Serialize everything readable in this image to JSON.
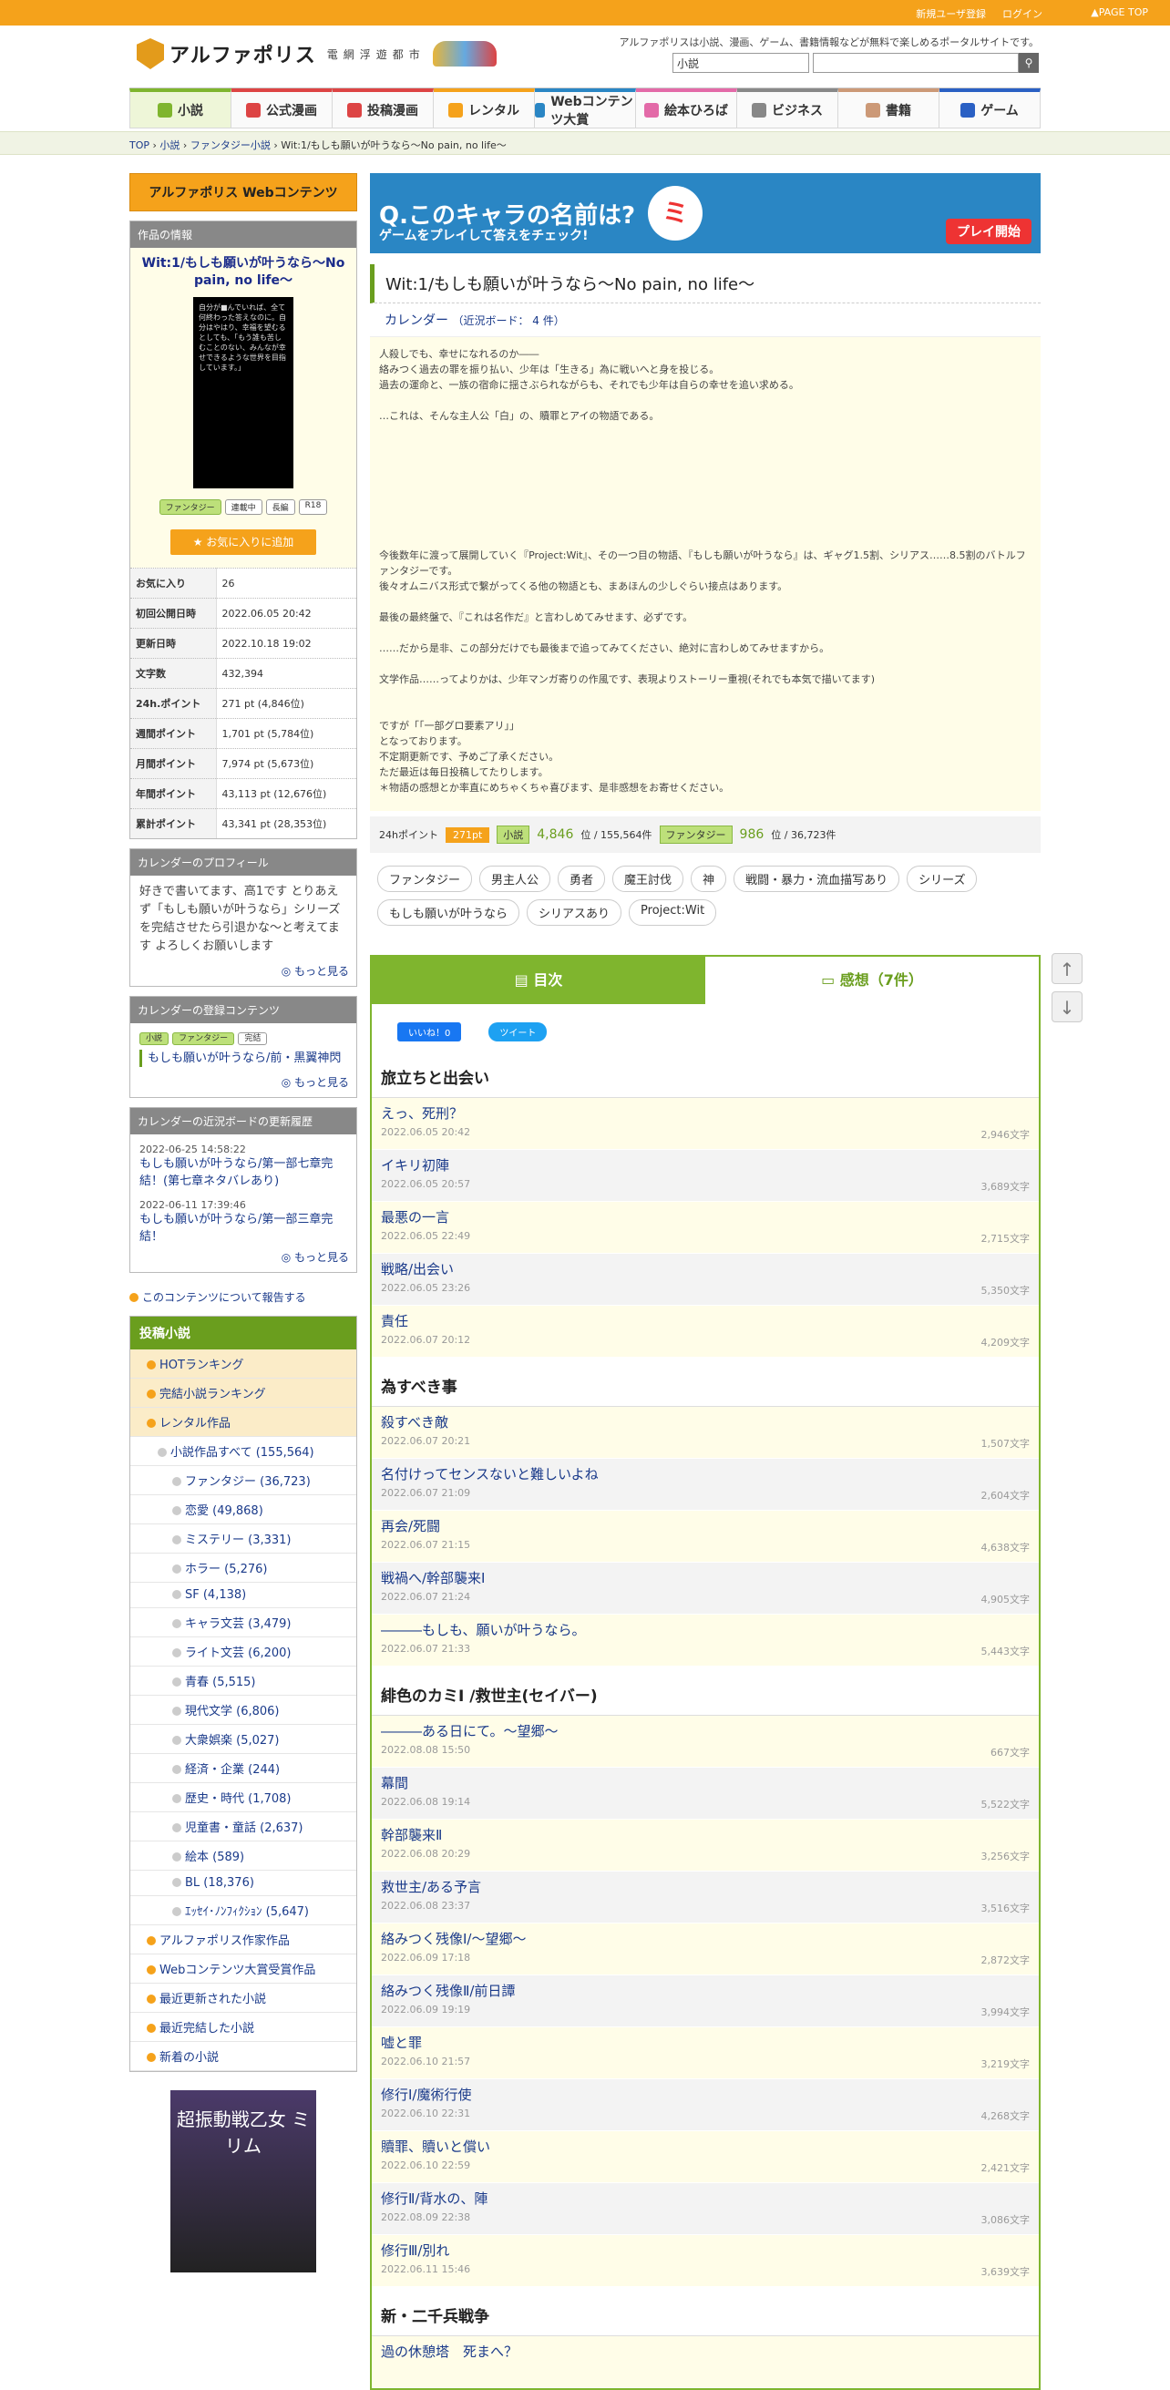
{
  "topbar": {
    "signup": "新規ユーザ登録",
    "login": "ログイン",
    "pagetop": "PAGE TOP"
  },
  "header": {
    "site_name": "アルファポリス",
    "site_sub": "電網浮遊都市",
    "tagline": "アルファポリスは小説、漫画、ゲーム、書籍情報などが無料で楽しめるポータルサイトです。",
    "search_category": "小説",
    "search_button": "search-icon"
  },
  "nav": [
    "小説",
    "公式漫画",
    "投稿漫画",
    "レンタル",
    "Webコンテンツ大賞",
    "絵本ひろば",
    "ビジネス",
    "書籍",
    "ゲーム"
  ],
  "breadcrumb": [
    "TOP",
    "小説",
    "ファンタジー小説",
    "Wit:1/もしも願いが叶うなら〜No pain, no life〜"
  ],
  "left": {
    "wc_banner": "アルファポリス Webコンテンツ",
    "info_header": "作品の情報",
    "work_title": "Wit:1/もしも願いが叶うなら〜No pain, no life〜",
    "cover_text": "自分が■んでいれば、全て何終わった答えなのに。自分はやはり、幸福を望むるとしても、「もう誰も苦しむことのない、みんなが幸せできるような世界を目指しています。」",
    "tags": [
      "ファンタジー",
      "連載中",
      "長編",
      "R18"
    ],
    "fav_button": "お気に入りに追加",
    "stats": [
      [
        "お気に入り",
        "26"
      ],
      [
        "初回公開日時",
        "2022.06.05 20:42"
      ],
      [
        "更新日時",
        "2022.10.18 19:02"
      ],
      [
        "文字数",
        "432,394"
      ],
      [
        "24h.ポイント",
        "271 pt (4,846位)"
      ],
      [
        "週間ポイント",
        "1,701 pt (5,784位)"
      ],
      [
        "月間ポイント",
        "7,974 pt (5,673位)"
      ],
      [
        "年間ポイント",
        "43,113 pt (12,676位)"
      ],
      [
        "累計ポイント",
        "43,341 pt (28,353位)"
      ]
    ],
    "profile_header": "カレンダーのプロフィール",
    "profile_text": "好きで書いてます、高1です とりあえず「もしも願いが叶うなら」シリーズを完結させたら引退かな〜と考えてます よろしくお願いします",
    "more": "もっと見る",
    "contents_header": "カレンダーの登録コンテンツ",
    "contents_tags": [
      "小説",
      "ファンタジー",
      "完結"
    ],
    "contents_title": "もしも願いが叶うなら/前・黒翼神閃",
    "history_header": "カレンダーの近況ボードの更新履歴",
    "history": [
      {
        "date": "2022-06-25 14:58:22",
        "title": "もしも願いが叶うなら/第一部七章完結！(第七章ネタバレあり)"
      },
      {
        "date": "2022-06-11 17:39:46",
        "title": "もしも願いが叶うなら/第一部三章完結！"
      }
    ],
    "report": "このコンテンツについて報告する",
    "menu_header": "投稿小説",
    "menu_items": [
      "HOTランキング",
      "完結小説ランキング",
      "レンタル作品",
      "小説作品すべて (155,564)"
    ],
    "menu_sub": [
      "ファンタジー (36,723)",
      "恋愛 (49,868)",
      "ミステリー (3,331)",
      "ホラー (5,276)",
      "SF (4,138)",
      "キャラ文芸 (3,479)",
      "ライト文芸 (6,200)",
      "青春 (5,515)",
      "現代文学 (6,806)",
      "大衆娯楽 (5,027)",
      "経済・企業 (244)",
      "歴史・時代 (1,708)",
      "児童書・童話 (2,637)",
      "絵本 (589)",
      "BL (18,376)",
      "ｴｯｾｲ･ﾉﾝﾌｨｸｼｮﾝ (5,647)"
    ],
    "menu_tail": [
      "アルファポリス作家作品",
      "Webコンテンツ大賞受賞作品",
      "最近更新された小説",
      "最近完結した小説",
      "新着の小説"
    ],
    "book_title": "超振動戦乙女 ミリム"
  },
  "main": {
    "ad": {
      "headline": "Q.このキャラの名前は?",
      "sub": "ゲームをプレイして答えをチェック!",
      "q": "ミ",
      "play": "プレイ開始"
    },
    "title": "Wit:1/もしも願いが叶うなら〜No pain, no life〜",
    "author": "カレンダー",
    "board": "（近況ボード： 4 件）",
    "synopsis": [
      "人殺しでも、幸せになれるのか――",
      "絡みつく過去の罪を振り払い、少年は「生きる」為に戦いへと身を投じる。",
      "過去の運命と、一族の宿命に揺さぶられながらも、それでも少年は自らの幸せを追い求める。",
      "",
      "…これは、そんな主人公「白」の、贖罪とアイの物語である。",
      "",
      "",
      "",
      "",
      "",
      "",
      "",
      "",
      "今後数年に渡って展開していく『Project:Wit』、その一つ目の物語、『もしも願いが叶うなら』は、ギャグ1.5割、シリアス……8.5割のバトルファンタジーです。",
      "後々オムニバス形式で繋がってくる他の物語とも、まあほんの少しぐらい接点はあります。",
      "",
      "最後の最終盤で、『これは名作だ』と言わしめてみせます、必ずです。",
      "",
      "……だから是非、この部分だけでも最後まで追ってみてください、絶対に言わしめてみせますから。",
      "",
      "文学作品……ってよりかは、少年マンガ寄りの作風です、表現よりストーリー重視(それでも本気で描いてます)",
      "",
      "",
      "ですが「「一部グロ要素アリ」」",
      "となっております。",
      "不定期更新です、予めご了承ください。",
      "ただ最近は毎日投稿してたりします。",
      "＊物語の感想とか率直にめちゃくちゃ喜びます、是非感想をお寄せください。"
    ],
    "points": {
      "label": "24hポイント",
      "badge": "271pt",
      "cat1": "小説",
      "rank1": "4,846",
      "total1": "位 / 155,564件",
      "cat2": "ファンタジー",
      "rank2": "986",
      "total2": "位 / 36,723件"
    },
    "keywords": [
      "ファンタジー",
      "男主人公",
      "勇者",
      "魔王討伐",
      "神",
      "戦闘・暴力・流血描写あり",
      "シリーズ",
      "もしも願いが叶うなら",
      "シリアスあり",
      "Project:Wit"
    ],
    "tabs": {
      "toc": "目次",
      "reviews": "感想（7件）"
    },
    "social": {
      "like": "いいね！0",
      "tweet": "ツイート"
    },
    "sections": [
      {
        "title": "旅立ちと出会い",
        "eps": [
          [
            "えっ、死刑？",
            "2022.06.05 20:42",
            "2,946文字"
          ],
          [
            "イキリ初陣",
            "2022.06.05 20:57",
            "3,689文字"
          ],
          [
            "最悪の一言",
            "2022.06.05 22:49",
            "2,715文字"
          ],
          [
            "戦略/出会い",
            "2022.06.05 23:26",
            "5,350文字"
          ],
          [
            "責任",
            "2022.06.07 20:12",
            "4,209文字"
          ]
        ]
      },
      {
        "title": "為すべき事",
        "eps": [
          [
            "殺すべき敵",
            "2022.06.07 20:21",
            "1,507文字"
          ],
          [
            "名付けってセンスないと難しいよね",
            "2022.06.07 21:09",
            "2,604文字"
          ],
          [
            "再会/死闘",
            "2022.06.07 21:15",
            "4,638文字"
          ],
          [
            "戦禍へ/幹部襲来Ⅰ",
            "2022.06.07 21:24",
            "4,905文字"
          ],
          [
            "―――もしも、願いが叶うなら。",
            "2022.06.07 21:33",
            "5,443文字"
          ]
        ]
      },
      {
        "title": "緋色のカミⅠ /救世主(セイバー)",
        "eps": [
          [
            "―――ある日にて。〜望郷〜",
            "2022.08.08 15:50",
            "667文字"
          ],
          [
            "幕間",
            "2022.06.08 19:14",
            "5,522文字"
          ],
          [
            "幹部襲来Ⅱ",
            "2022.06.08 20:29",
            "3,256文字"
          ],
          [
            "救世主/ある予言",
            "2022.06.08 23:37",
            "3,516文字"
          ],
          [
            "絡みつく残像Ⅰ/〜望郷〜",
            "2022.06.09 17:18",
            "2,872文字"
          ],
          [
            "絡みつく残像Ⅱ/前日譚",
            "2022.06.09 19:19",
            "3,994文字"
          ],
          [
            "嘘と罪",
            "2022.06.10 21:57",
            "3,219文字"
          ],
          [
            "修行Ⅰ/魔術行使",
            "2022.06.10 22:31",
            "4,268文字"
          ],
          [
            "贖罪、贖いと償い",
            "2022.06.10 22:59",
            "2,421文字"
          ],
          [
            "修行Ⅱ/背水の、陣",
            "2022.08.09 22:38",
            "3,086文字"
          ],
          [
            "修行Ⅲ/別れ",
            "2022.06.11 15:46",
            "3,639文字"
          ]
        ]
      },
      {
        "title": "新・二千兵戦争",
        "eps": [
          [
            "過の休憩塔　死まへ？",
            "",
            ""
          ]
        ]
      }
    ]
  }
}
